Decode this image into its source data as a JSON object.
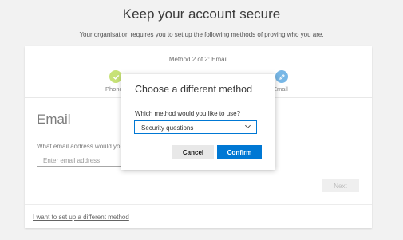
{
  "header": {
    "title": "Keep your account secure",
    "subtitle": "Your organisation requires you to set up the following methods of proving who you are."
  },
  "progress": {
    "step_text": "Method 2 of 2: Email",
    "steps": [
      {
        "label": "Phone",
        "status": "complete",
        "icon": "checkmark-icon"
      },
      {
        "label": "Email",
        "status": "current",
        "icon": "pencil-icon"
      }
    ]
  },
  "email_section": {
    "heading": "Email",
    "question": "What email address would you",
    "input_placeholder": "Enter email address",
    "next_label": "Next"
  },
  "footer": {
    "different_method_link": "I want to set up a different method"
  },
  "dialog": {
    "title": "Choose a different method",
    "question": "Which method would you like to use?",
    "selected_method": "Security questions",
    "cancel_label": "Cancel",
    "confirm_label": "Confirm"
  },
  "colors": {
    "accent": "#0078d4",
    "step_complete": "#b4d94a",
    "step_current": "#4a9fde"
  }
}
